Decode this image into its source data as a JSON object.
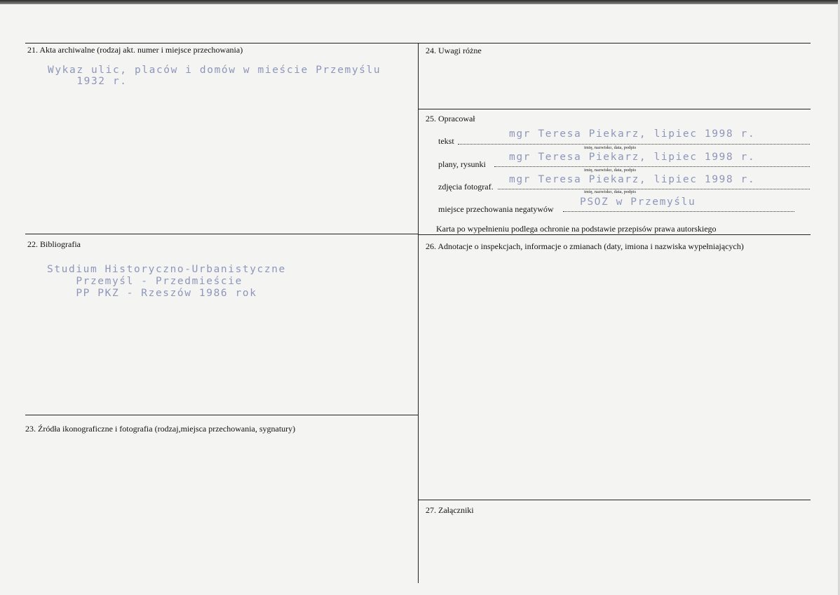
{
  "section21": {
    "label": "21. Akta archiwalne (rodzaj akt. numer i miejsce przechowania)",
    "lines": [
      "Wykaz ulic, placów i domów w mieście Przemyślu",
      "    1932 r."
    ]
  },
  "section22": {
    "label": "22. Bibliografia",
    "lines": [
      "Studium Historyczno-Urbanistyczne",
      "    Przemyśl - Przedmieście",
      "    PP PKZ - Rzeszów 1986 rok"
    ]
  },
  "section23": {
    "label": "23. Źródła ikonograficzne i fotografia (rodzaj,miejsca przechowania, sygnatury)"
  },
  "section24": {
    "label": "24. Uwagi różne"
  },
  "section25": {
    "label": "25. Opracował",
    "hint": "imię, nazwisko, data, podpis",
    "rows": [
      {
        "label": "tekst",
        "value": "mgr Teresa Piekarz, lipiec 1998 r."
      },
      {
        "label": "plany, rysunki",
        "value": "mgr Teresa Piekarz, lipiec 1998 r."
      },
      {
        "label": "zdjęcia fotograf.",
        "value": "mgr Teresa Piekarz, lipiec 1998 r."
      },
      {
        "label": "miejsce przechowania negatywów",
        "value": "PSOZ w Przemyślu"
      }
    ],
    "note": "Karta po wypełnieniu podlega ochronie na podstawie przepisów prawa autorskiego"
  },
  "section26": {
    "label": "26. Adnotacje o inspekcjach, informacje o zmianach (daty, imiona i nazwiska wypełniających)"
  },
  "section27": {
    "label": "27. Załączniki"
  }
}
